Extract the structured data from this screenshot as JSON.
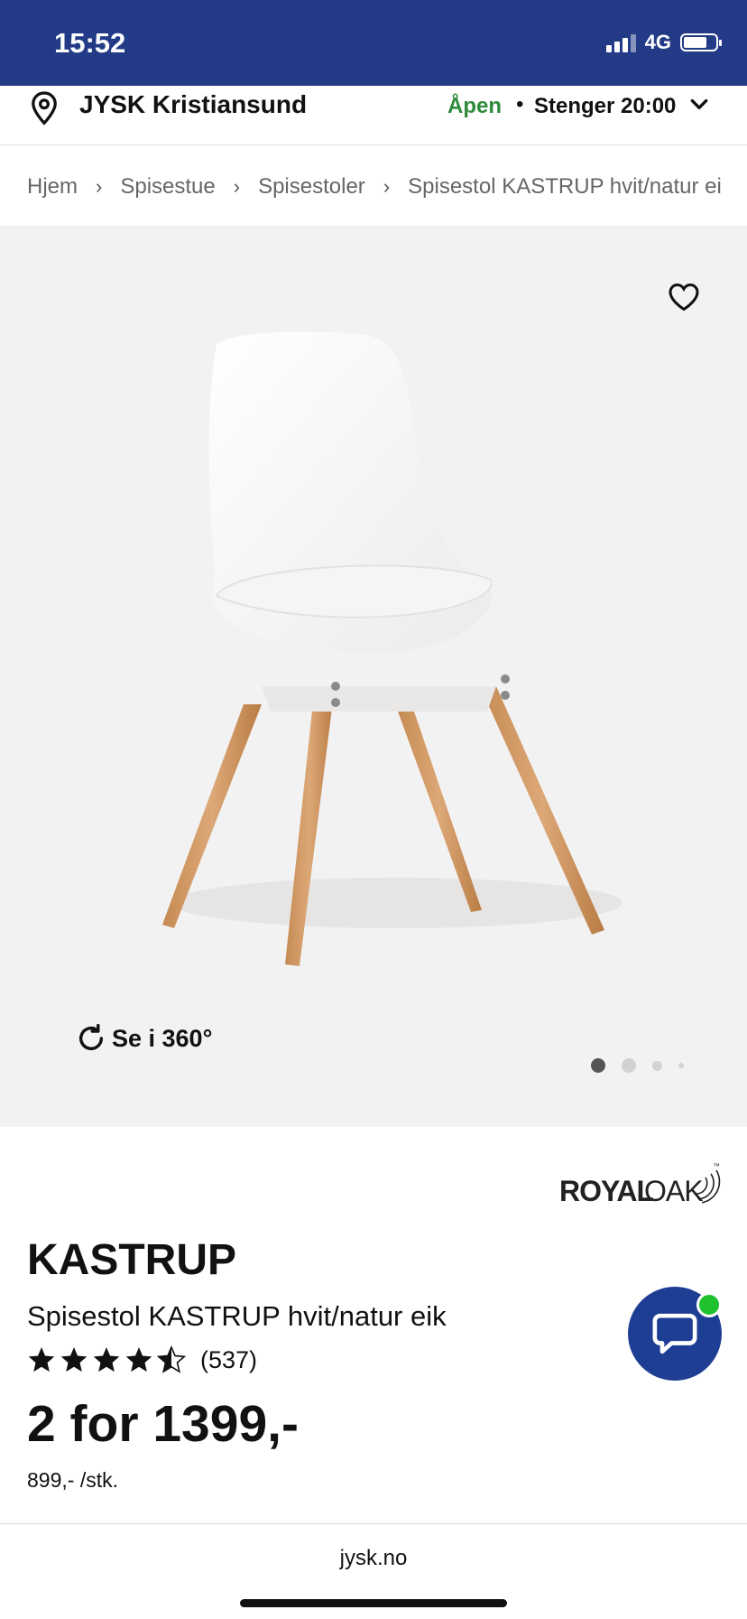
{
  "status_bar": {
    "time": "15:52",
    "network": "4G",
    "battery_level": 0.75
  },
  "store": {
    "name": "JYSK Kristiansund",
    "open_label": "Åpen",
    "separator": "•",
    "closes": "Stenger 20:00",
    "open_color": "#2e8b3c"
  },
  "breadcrumb": [
    "Hjem",
    "Spisestue",
    "Spisestoler",
    "Spisestol KASTRUP hvit/natur eik"
  ],
  "gallery": {
    "view360_label": "Se i 360°",
    "image_count": 4,
    "active_image": 1
  },
  "brand": {
    "name_primary": "ROYAL",
    "name_secondary": "OAK",
    "trademark": "™"
  },
  "product": {
    "title": "KASTRUP",
    "subtitle": "Spisestol KASTRUP hvit/natur eik",
    "rating": 4.5,
    "rating_count": "(537)",
    "price": "2 for 1399,-",
    "unit_price": "899,- /stk."
  },
  "browser": {
    "url": "jysk.no"
  },
  "colors": {
    "header_bg": "#233b86",
    "accent": "#1d3e93",
    "online": "#1fc12f"
  },
  "icons": [
    "location-pin-icon",
    "chevron-down-icon",
    "heart-icon",
    "rotate-360-icon",
    "star-icon",
    "chat-icon"
  ]
}
